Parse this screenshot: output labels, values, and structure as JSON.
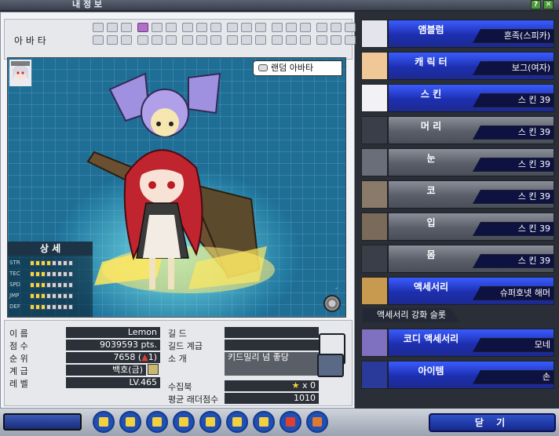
{
  "window": {
    "title": "내 정 보"
  },
  "avatar_header": {
    "label": "아 바 타",
    "slot_rows": 2,
    "slot_cols": 18,
    "active_slot": 3
  },
  "stage": {
    "random_avatar_label": "랜덤 아바타",
    "detail_title": "상 세",
    "stats": [
      {
        "name": "STR",
        "filled": 4
      },
      {
        "name": "TEC",
        "filled": 3
      },
      {
        "name": "SPD",
        "filled": 3
      },
      {
        "name": "JMP",
        "filled": 3
      },
      {
        "name": "DEF",
        "filled": 3
      }
    ],
    "stat_bar_total": 8,
    "zoom_label": "-"
  },
  "profile": {
    "name_label": "이 름",
    "name": "Lemon",
    "score_label": "점 수",
    "score": "9039593 pts.",
    "rank_label": "순 위",
    "rank": "7658 (",
    "rank_change": "1)",
    "grade_label": "계 급",
    "grade": "백호(금)",
    "level_label": "레 벨",
    "level": "LV.465",
    "guild_label": "길 드",
    "guild": "",
    "guild_rank_label": "길드 계급",
    "guild_rank": "",
    "intro_label": "소 개",
    "intro": "키드밀리 넘 좋당",
    "collection_label": "수집북",
    "collection": "x 0",
    "ladder_label": "평균 래더점수",
    "ladder": "1010"
  },
  "right_rows": [
    {
      "label": "앰블럼",
      "value": "혼족(스피카)",
      "style": "blue"
    },
    {
      "label": "캐 릭 터",
      "value": "보그(여자)",
      "style": "blue"
    },
    {
      "label": "스    킨",
      "value": "스    킨 39",
      "style": "blue"
    },
    {
      "label": "머    리",
      "value": "스    킨 39",
      "style": "grey"
    },
    {
      "label": "눈",
      "value": "스    킨 39",
      "style": "grey"
    },
    {
      "label": "코",
      "value": "스    킨 39",
      "style": "grey"
    },
    {
      "label": "입",
      "value": "스    킨 39",
      "style": "grey"
    },
    {
      "label": "몸",
      "value": "스    킨 39",
      "style": "grey"
    },
    {
      "label": "액세서리",
      "value": "슈퍼호넷 해머",
      "style": "blue"
    },
    {
      "label": "코디 액세서리",
      "value": "모네",
      "style": "blue"
    },
    {
      "label": "아이템",
      "value": "손",
      "style": "blue"
    }
  ],
  "enhance_slot_label": "액세서리 강화 슬롯",
  "toolbar": {
    "icons": [
      "cube-icon",
      "chat-icon",
      "box-icon",
      "shield-icon",
      "star-icon",
      "bag-icon",
      "bell-icon",
      "chart-icon",
      "card-icon"
    ],
    "close_label": "닫 기"
  },
  "colors": {
    "accent_blue": "#2e52ff",
    "stage_bg": "#1e6e96",
    "stat_on": "#f2d93a"
  }
}
